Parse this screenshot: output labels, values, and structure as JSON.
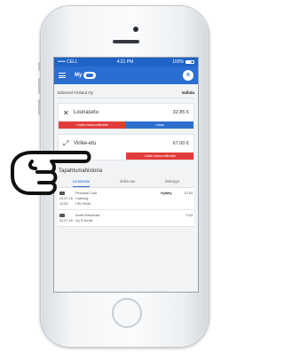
{
  "status_bar": {
    "carrier": "••••• CELL",
    "time": "4:21 PM",
    "battery": "100%"
  },
  "app_bar": {
    "title": "My"
  },
  "avatar_initial": "R",
  "company": {
    "name": "Edenred Finland Oy",
    "switch_label": "Vaihda"
  },
  "benefits": [
    {
      "icon": "cutlery-icon",
      "name": "Lounasetu",
      "amount": "32.85 €",
      "primary_action": "Lisää maksuvälineitä",
      "secondary_action": "Lataa"
    },
    {
      "icon": "exercise-icon",
      "name": "Virike-etu",
      "amount": "67.00 €",
      "primary_action": "Lisää maksuvälineitä"
    }
  ],
  "history": {
    "title": "Tapahtumahistoria",
    "tabs": [
      "Lounasetu",
      "Virike-etu",
      "Ostoryys"
    ],
    "active_tab": 0,
    "rows": [
      {
        "date": "03.07.18",
        "time": "12:55",
        "merchant": "Personal Care",
        "category": "Catering",
        "place": "HELSINKI",
        "status": "Hylätty",
        "amount": "10.53"
      },
      {
        "date": "02.07.18",
        "merchant": "Antell Ravintolat",
        "category": "Oy ® Arnell",
        "amount": "9.63"
      }
    ]
  },
  "colors": {
    "accent": "#2a6ed2",
    "action_red": "#e23b3b",
    "action_blue": "#2e6fd0"
  }
}
